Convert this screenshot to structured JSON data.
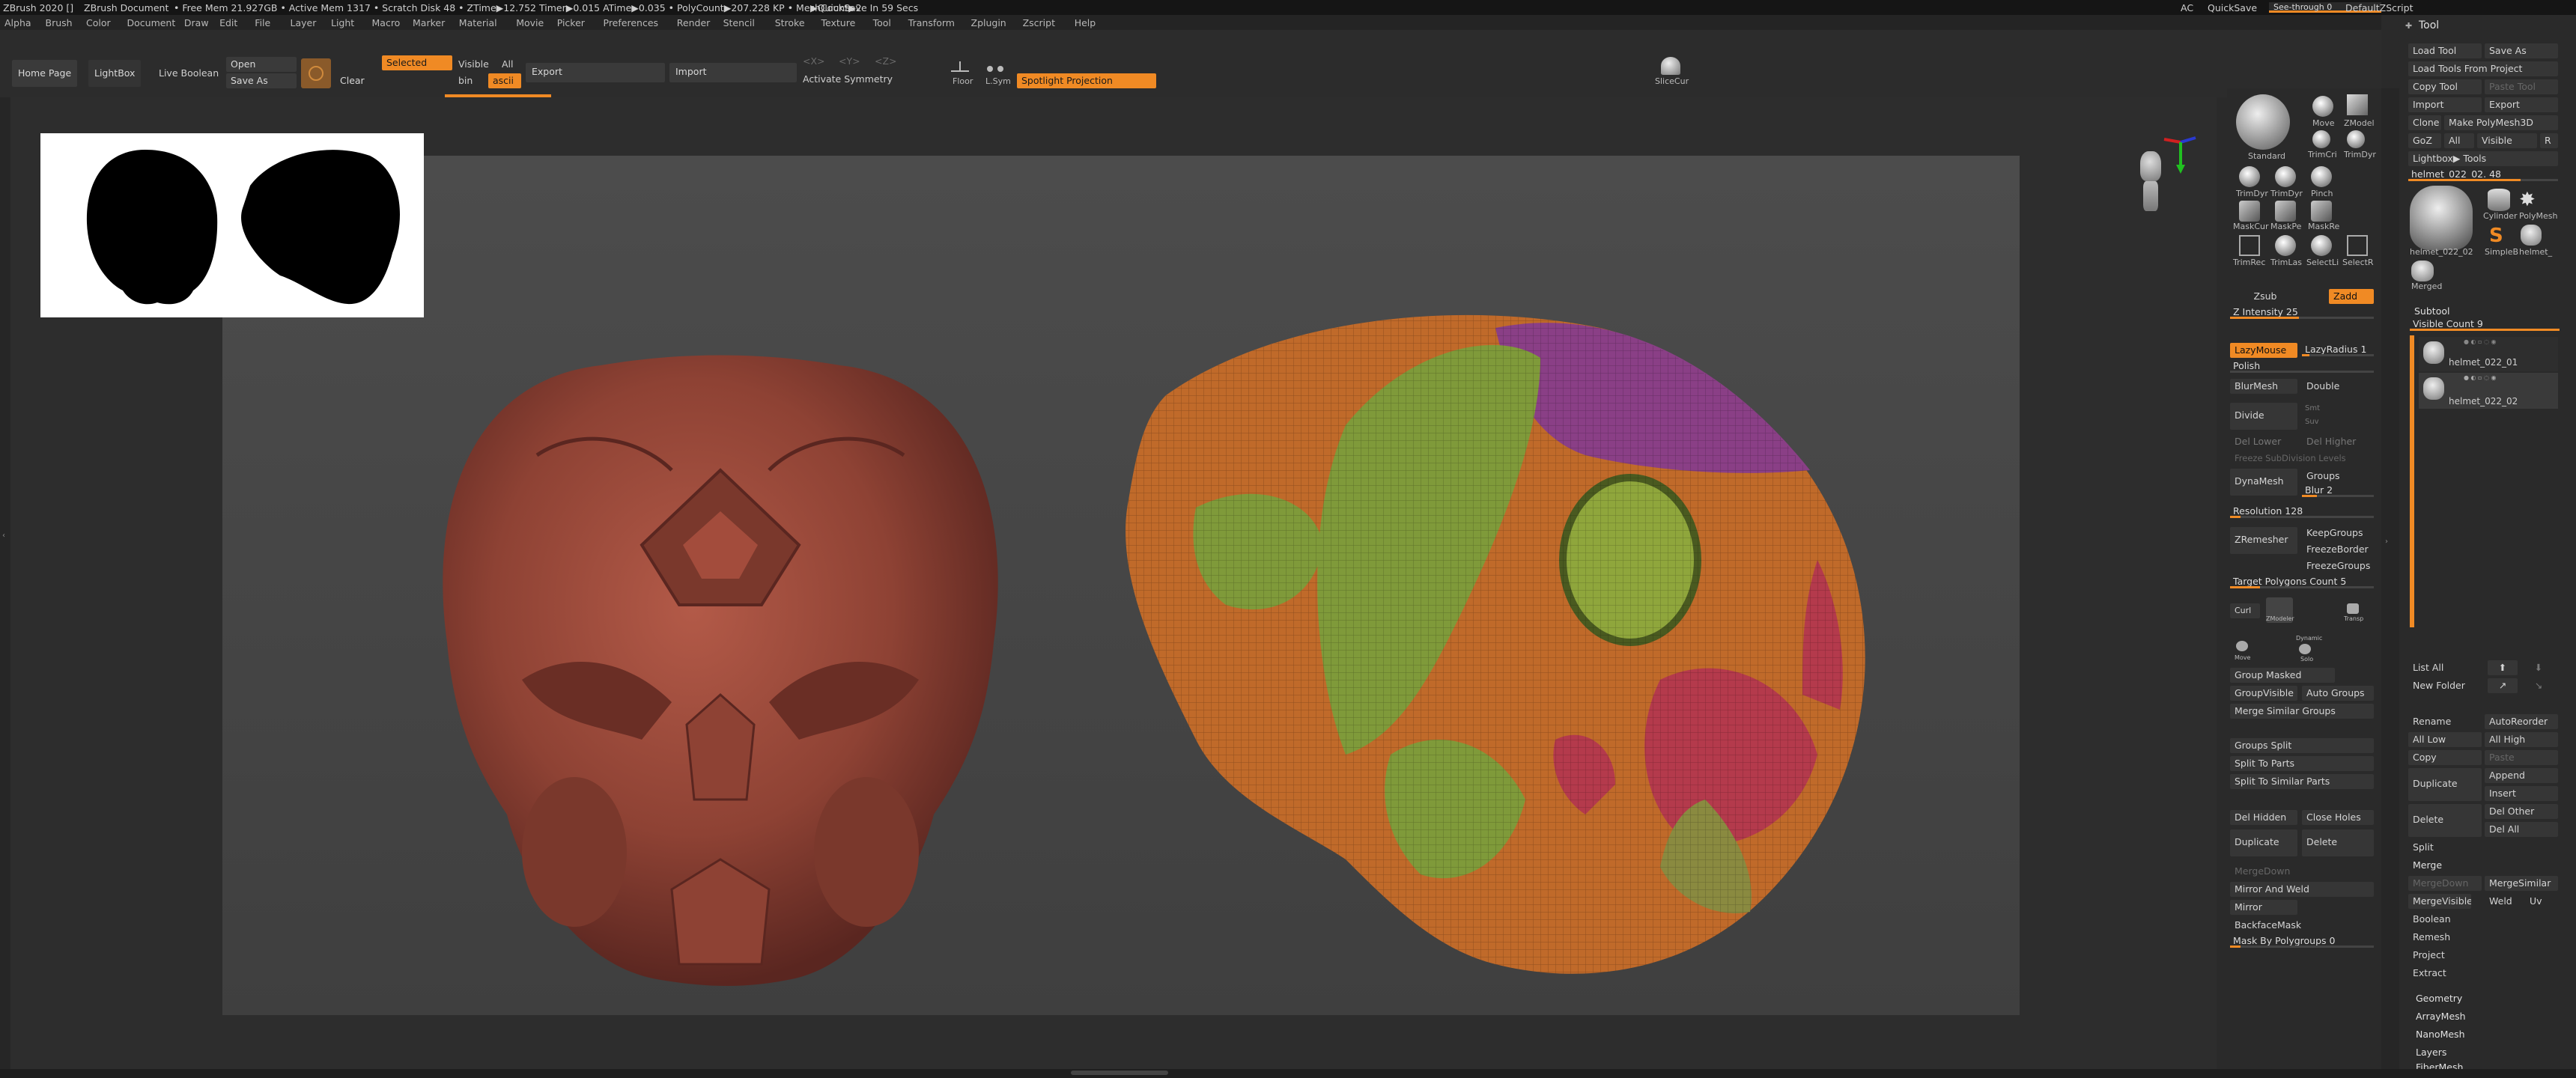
{
  "titlebar": {
    "app": "ZBrush 2020 []",
    "doc": "ZBrush Document",
    "stats": "• Free Mem 21.927GB • Active Mem 1317 • Scratch Disk 48 • ZTime▶12.752 Timer▶0.015 ATime▶0.035 • PolyCount▶207.228 KP • MeshCount▶2",
    "autosave": "▶QuickSave In 59 Secs",
    "ac": "AC",
    "quicksave": "QuickSave",
    "seethrough": "See-through  0",
    "script": "DefaultZScript"
  },
  "menu": [
    "Alpha",
    "Brush",
    "Color",
    "Document",
    "Draw",
    "Edit",
    "File",
    "Layer",
    "Light",
    "Macro",
    "Marker",
    "Material",
    "Movie",
    "Picker",
    "Preferences",
    "Render",
    "Stencil",
    "Stroke",
    "Texture",
    "Tool",
    "Transform",
    "Zplugin",
    "Zscript",
    "Help"
  ],
  "shelf": {
    "home": "Home Page",
    "lightbox": "LightBox",
    "live_boolean": "Live Boolean",
    "open": "Open",
    "save_as": "Save As",
    "selected": "Selected",
    "clear": "Clear",
    "visible": "Visible",
    "all": "All",
    "bin": "bin",
    "ascii": "ascii",
    "export": "Export",
    "import": "Import",
    "sym_x": "<X>",
    "sym_y": "<Y>",
    "sym_z": "<Z>",
    "activate_symmetry": "Activate Symmetry",
    "floor": "Floor",
    "lsym": "L.Sym",
    "spotlight": "Spotlight Projection",
    "slicecur": "SliceCur"
  },
  "mid": {
    "zsub": "Zsub",
    "zadd": "Zadd",
    "z_intensity": "Z Intensity 25",
    "lazymouse": "LazyMouse",
    "lazyradius": "LazyRadius 1",
    "polish": "Polish",
    "blurmesh": "BlurMesh",
    "double": "Double",
    "divide": "Divide",
    "smt": "Smt",
    "suv": "Suv",
    "del_lower": "Del Lower",
    "del_higher": "Del Higher",
    "freeze_sub": "Freeze SubDivision Levels",
    "dynamesh": "DynaMesh",
    "groups": "Groups",
    "blur": "Blur 2",
    "resolution": "Resolution 128",
    "zremesher": "ZRemesher",
    "keepgroups": "KeepGroups",
    "freezeborder": "FreezeBorder",
    "freezegroups": "FreezeGroups",
    "target_poly": "Target Polygons Count 5",
    "curl": "Curl",
    "zmodeler": "ZModeler",
    "transp": "Transp",
    "move": "Move",
    "dynamic": "Dynamic",
    "solo": "Solo",
    "group_masked": "Group Masked",
    "groupvisible": "GroupVisible",
    "auto_groups": "Auto Groups",
    "merge_similar_groups": "Merge Similar Groups",
    "groups_split": "Groups Split",
    "split_to_parts": "Split To Parts",
    "split_similar": "Split To Similar Parts",
    "del_hidden": "Del Hidden",
    "close_holes": "Close Holes",
    "duplicate": "Duplicate",
    "delete": "Delete",
    "mergedown": "MergeDown",
    "mirror_weld": "Mirror And Weld",
    "mirror": "Mirror",
    "backfacemask": "BackfaceMask",
    "mask_by_poly": "Mask By Polygroups 0"
  },
  "right": {
    "tool": "Tool",
    "load_tool": "Load Tool",
    "save_as": "Save As",
    "load_project": "Load Tools From Project",
    "copy_tool": "Copy Tool",
    "paste_tool": "Paste Tool",
    "import": "Import",
    "export": "Export",
    "clone": "Clone",
    "make_polymesh": "Make PolyMesh3D",
    "goz": "GoZ",
    "all": "All",
    "visible": "Visible",
    "r": "R",
    "lightbox_tools": "Lightbox▶ Tools",
    "current_tool": "helmet_022_02. 48",
    "thumb_labels": [
      "Cylinder",
      "PolyMesh",
      "helmet_022_02",
      "SimpleB",
      "helmet_",
      "Merged"
    ],
    "subtool": "Subtool",
    "visible_count": "Visible Count 9",
    "subtools": [
      "helmet_022_01",
      "helmet_022_02"
    ],
    "list_all": "List All",
    "new_folder": "New Folder",
    "rename": "Rename",
    "autoreorder": "AutoReorder",
    "all_low": "All Low",
    "all_high": "All High",
    "copy": "Copy",
    "paste": "Paste",
    "duplicate": "Duplicate",
    "append": "Append",
    "insert": "Insert",
    "delete": "Delete",
    "del_other": "Del Other",
    "del_all": "Del All",
    "split": "Split",
    "merge": "Merge",
    "mergedown": "MergeDown",
    "mergesimilar": "MergeSimilar",
    "mergevisible": "MergeVisible",
    "weld": "Weld",
    "uv": "Uv",
    "boolean": "Boolean",
    "remesh": "Remesh",
    "project": "Project",
    "extract": "Extract",
    "geometry": "Geometry",
    "arraymesh": "ArrayMesh",
    "nanomesh": "NanoMesh",
    "layers": "Layers",
    "fibermesh": "FiberMesh"
  },
  "brushes": [
    "Standard",
    "Move",
    "ZModel",
    "TrimCri",
    "TrimDyr",
    "TrimDyr",
    "TrimDyr",
    "Pinch",
    "MaskCur",
    "MaskPe",
    "MaskRe",
    "TrimRec",
    "TrimLas",
    "SelectLi",
    "SelectR"
  ],
  "colors": {
    "accent": "#f08a24",
    "clay": "#9a4a3c",
    "polygroup_green": "#7f9a3a",
    "polygroup_purple": "#8a3f86",
    "polygroup_red": "#b43a4c",
    "polygroup_orange": "#c06a2a"
  }
}
